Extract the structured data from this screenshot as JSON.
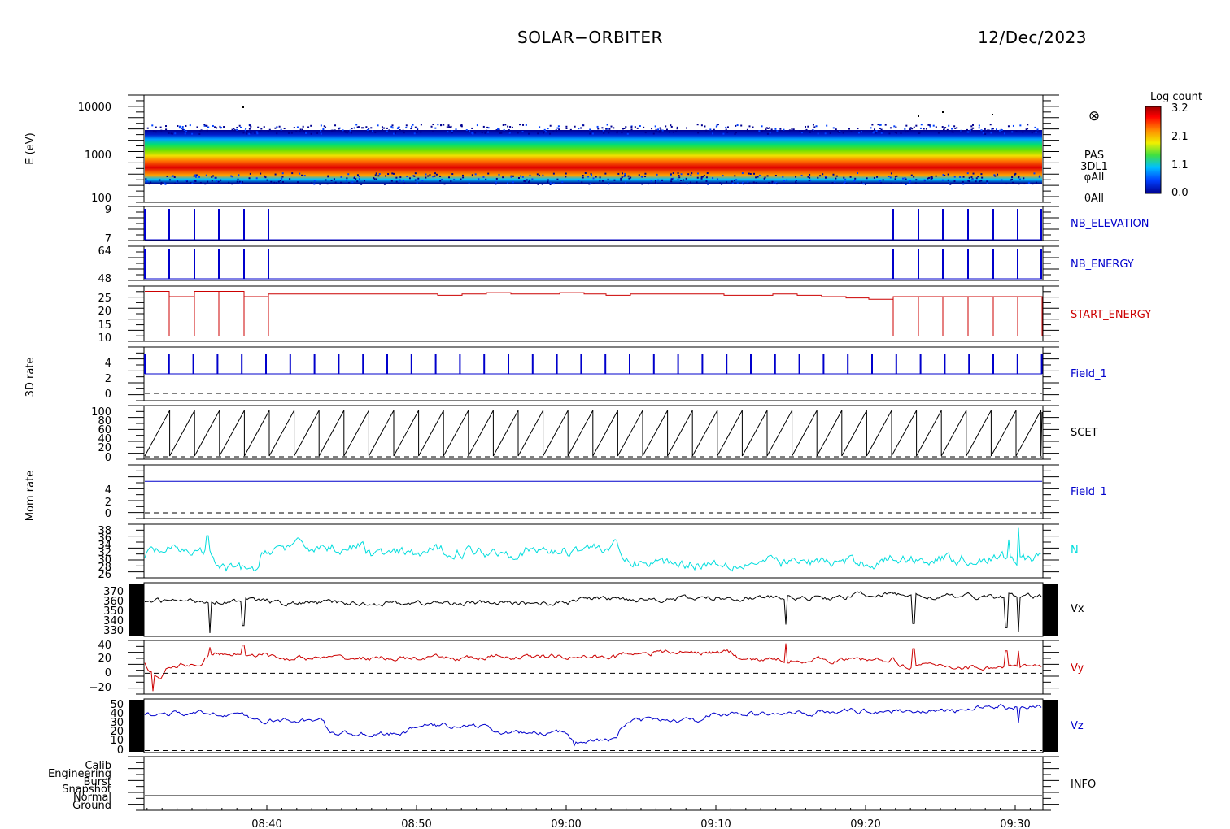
{
  "header": {
    "spacecraft": "SOLAR−ORBITER",
    "date": "12/Dec/2023"
  },
  "colorbar": {
    "title": "Log count",
    "ticks": [
      "3.2",
      "2.1",
      "1.1",
      "0.0"
    ]
  },
  "chart_data": [
    {
      "type": "heatmap",
      "id": "pas-spectrogram",
      "ylabel": "E (eV)",
      "yscale": "log",
      "ylim": [
        100,
        15000
      ],
      "ticks": [
        "10000",
        "1000",
        "100"
      ],
      "labels": [
        "PAS",
        "3DL1",
        "φAll",
        "θAll"
      ],
      "symbol": "⊗",
      "peak_energy_ev": 750,
      "color_range": [
        0.0,
        3.2
      ]
    },
    {
      "type": "line",
      "id": "nb-elevation",
      "name": "NB_ELEVATION",
      "color": "#0000cc",
      "ylim": [
        7,
        9
      ],
      "ticks": [
        "9",
        "7"
      ]
    },
    {
      "type": "line",
      "id": "nb-energy",
      "name": "NB_ENERGY",
      "color": "#0000cc",
      "ylim": [
        48,
        64
      ],
      "ticks": [
        "64",
        "48"
      ]
    },
    {
      "type": "line",
      "id": "start-energy",
      "name": "START_ENERGY",
      "color": "#cc0000",
      "ylim": [
        8,
        29
      ],
      "ticks": [
        "25",
        "20",
        "15",
        "10"
      ]
    },
    {
      "type": "line",
      "id": "field-1-3d",
      "name": "Field_1",
      "color": "#0000cc",
      "ylabel": "3D rate",
      "ylim": [
        -1,
        5
      ],
      "ticks": [
        "4",
        "2",
        "0"
      ]
    },
    {
      "type": "line",
      "id": "scet",
      "name": "SCET",
      "color": "#000000",
      "ylim": [
        0,
        100
      ],
      "ticks": [
        "100",
        "80",
        "60",
        "40",
        "20",
        "0"
      ]
    },
    {
      "type": "line",
      "id": "field-1-mom",
      "name": "Field_1",
      "color": "#0000cc",
      "ylabel": "Mom rate",
      "ylim": [
        -0.5,
        6
      ],
      "ticks": [
        "4",
        "2",
        "0"
      ],
      "value": 4
    },
    {
      "type": "line",
      "id": "density-n",
      "name": "N",
      "color": "#00dddd",
      "ylim": [
        25,
        39
      ],
      "ticks": [
        "38",
        "36",
        "34",
        "32",
        "30",
        "28",
        "26"
      ]
    },
    {
      "type": "line",
      "id": "velocity-vx",
      "name": "Vx",
      "color": "#000000",
      "ylim": [
        325,
        375
      ],
      "ticks": [
        "370",
        "360",
        "350",
        "340",
        "330"
      ]
    },
    {
      "type": "line",
      "id": "velocity-vy",
      "name": "Vy",
      "color": "#cc0000",
      "ylim": [
        -28,
        44
      ],
      "ticks": [
        "40",
        "20",
        "0",
        "−20"
      ]
    },
    {
      "type": "line",
      "id": "velocity-vz",
      "name": "Vz",
      "color": "#0000cc",
      "ylim": [
        -2,
        52
      ],
      "ticks": [
        "50",
        "40",
        "30",
        "20",
        "10",
        "0"
      ]
    },
    {
      "type": "table",
      "id": "info",
      "name": "INFO",
      "ticks": [
        "Calib",
        "Engineering",
        "Burst",
        "Snapshot",
        "Normal",
        "Ground"
      ]
    }
  ],
  "time_axis": {
    "range": [
      "08:31:45",
      "09:32:00"
    ],
    "ticks": [
      "08:40",
      "08:50",
      "09:00",
      "09:10",
      "09:20",
      "09:30"
    ]
  }
}
